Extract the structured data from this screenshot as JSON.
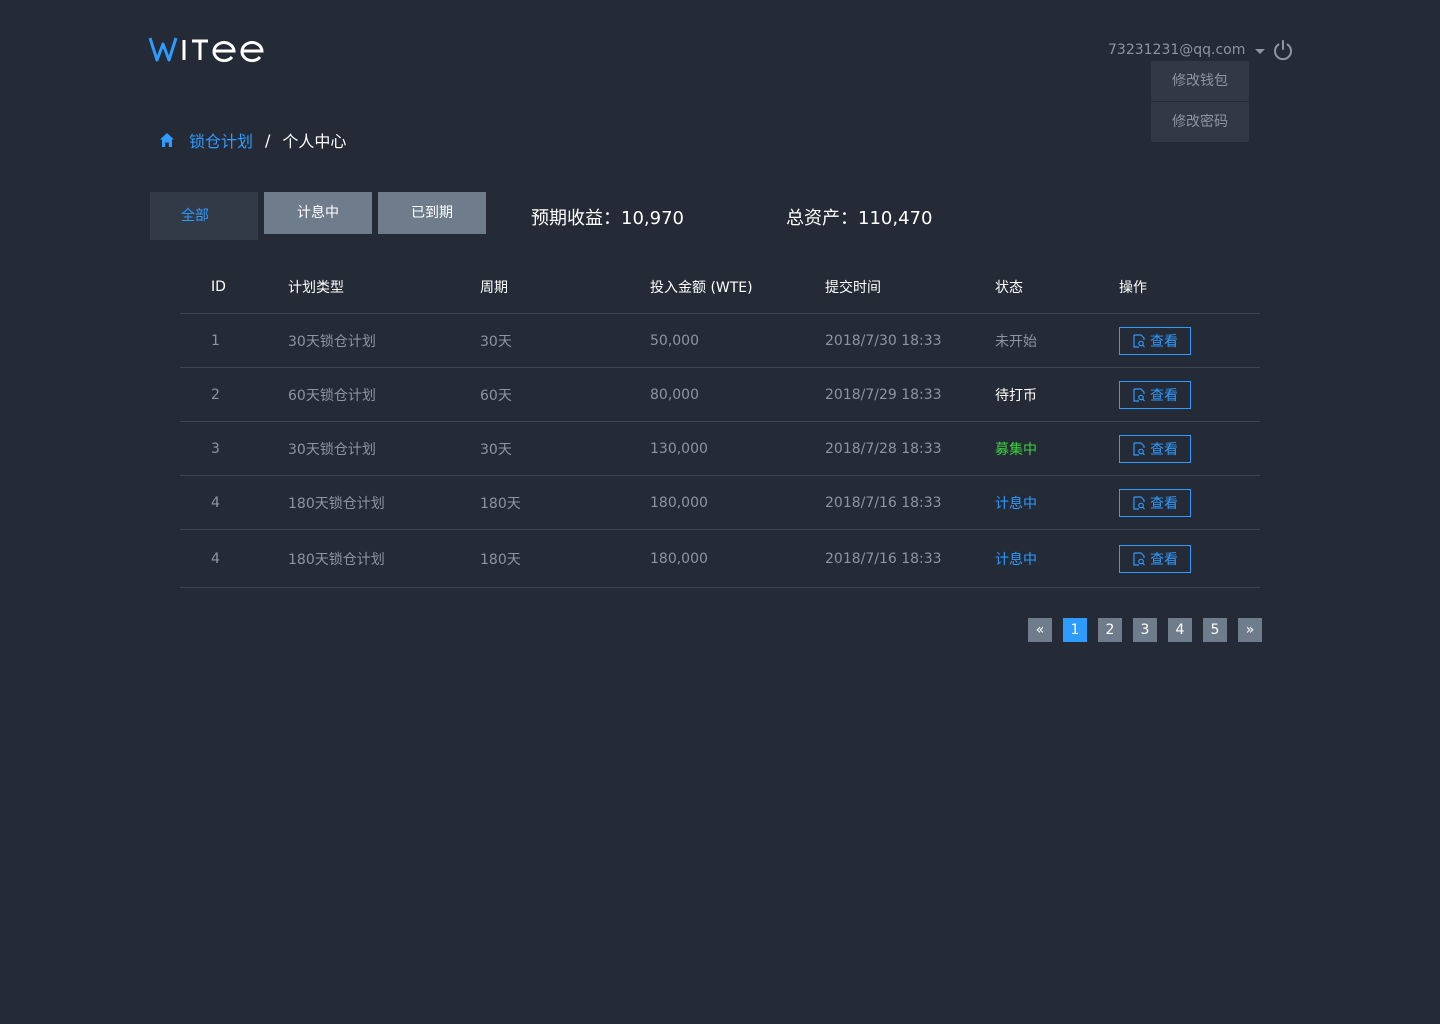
{
  "header": {
    "logo_text": "WITee",
    "user_email": "73231231@qq.com",
    "dropdown": [
      "修改钱包",
      "修改密码"
    ]
  },
  "breadcrumb": {
    "link": "锁仓计划",
    "separator": "/",
    "current": "个人中心"
  },
  "tabs": [
    {
      "label": "全部",
      "active": true
    },
    {
      "label": "计息中",
      "active": false
    },
    {
      "label": "已到期",
      "active": false
    }
  ],
  "summary": {
    "expected_label": "预期收益：",
    "expected_value": "10,970",
    "total_label": "总资产：",
    "total_value": "110,470"
  },
  "table": {
    "headers": [
      "ID",
      "计划类型",
      "周期",
      "投入金额 (WTE)",
      "提交时间",
      "状态",
      "操作"
    ],
    "rows": [
      {
        "id": "1",
        "type": "30天锁仓计划",
        "period": "30天",
        "amount": "50,000",
        "time": "2018/7/30 18:33",
        "status": "未开始",
        "status_kind": "notstarted",
        "action": "查看"
      },
      {
        "id": "2",
        "type": "60天锁仓计划",
        "period": "60天",
        "amount": "80,000",
        "time": "2018/7/29 18:33",
        "status": "待打币",
        "status_kind": "pending",
        "action": "查看"
      },
      {
        "id": "3",
        "type": "30天锁仓计划",
        "period": "30天",
        "amount": "130,000",
        "time": "2018/7/28 18:33",
        "status": "募集中",
        "status_kind": "raising",
        "action": "查看"
      },
      {
        "id": "4",
        "type": "180天锁仓计划",
        "period": "180天",
        "amount": "180,000",
        "time": "2018/7/16 18:33",
        "status": "计息中",
        "status_kind": "interest",
        "action": "查看"
      },
      {
        "id": "4",
        "type": "180天锁仓计划",
        "period": "180天",
        "amount": "180,000",
        "time": "2018/7/16 18:33",
        "status": "计息中",
        "status_kind": "interest",
        "action": "查看"
      }
    ]
  },
  "pagination": {
    "prev": "«",
    "pages": [
      "1",
      "2",
      "3",
      "4",
      "5"
    ],
    "current": "1",
    "next": "»"
  },
  "colors": {
    "background": "#242a36",
    "accent": "#2e9bff",
    "raising": "#3fcf3f",
    "button_gray": "#6f7c8b"
  }
}
